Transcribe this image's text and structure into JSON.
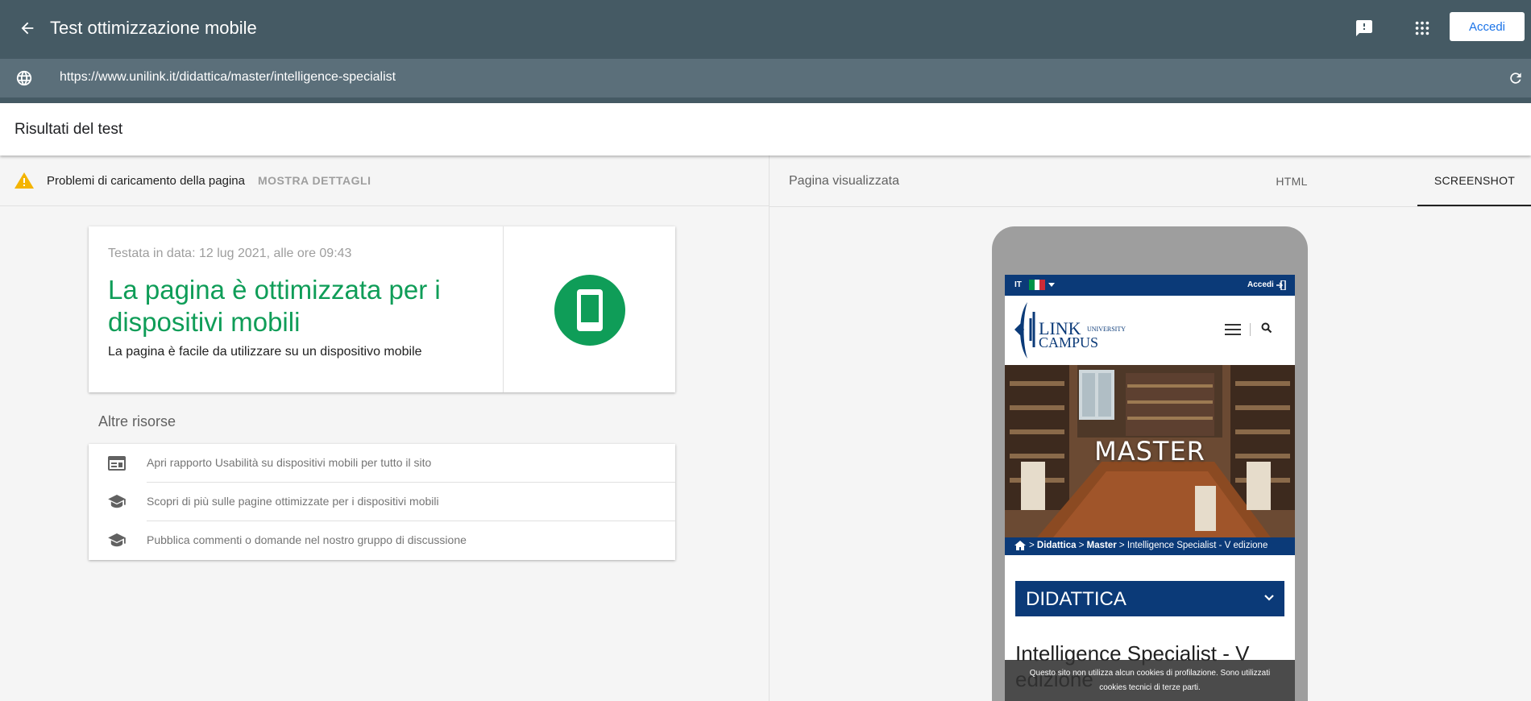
{
  "app": {
    "title": "Test ottimizzazione mobile",
    "signin_label": "Accedi",
    "url": "https://www.unilink.it/didattica/master/intelligence-specialist"
  },
  "results": {
    "title": "Risultati del test",
    "issue_text": "Problemi di caricamento della pagina",
    "details_label": "MOSTRA DETTAGLI"
  },
  "card": {
    "tested": "Testata in data: 12 lug 2021, alle ore 09:43",
    "verdict": "La pagina è ottimizzata per i dispositivi mobili",
    "subtitle": "La pagina è facile da utilizzare su un dispositivo mobile"
  },
  "resources": {
    "title": "Altre risorse",
    "items": [
      {
        "label": "Apri rapporto Usabilità su dispositivi mobili per tutto il sito",
        "icon": "web-report-icon"
      },
      {
        "label": "Scopri di più sulle pagine ottimizzate per i dispositivi mobili",
        "icon": "school-icon"
      },
      {
        "label": "Pubblica commenti o domande nel nostro gruppo di discussione",
        "icon": "school-icon"
      }
    ]
  },
  "rendered": {
    "title": "Pagina visualizzata",
    "tabs": [
      {
        "label": "HTML",
        "selected": false
      },
      {
        "label": "SCREENSHOT",
        "selected": true
      }
    ]
  },
  "preview": {
    "lang": "IT",
    "accedi": "Accedi",
    "logo_main": "LINK",
    "logo_campus": "CAMPUS",
    "logo_university": "UNIVERSITY",
    "hero_title": "MASTER",
    "breadcrumb": {
      "sep": ">",
      "didattica": "Didattica",
      "master": "Master",
      "current": "Intelligence Specialist - V edizione"
    },
    "section": "DIDATTICA",
    "page_title": "Intelligence Specialist - V edizione",
    "cookie_line1": "Questo sito non utilizza alcun cookies di profilazione. Sono utilizzati",
    "cookie_line2": "cookies tecnici di terze parti."
  },
  "colors": {
    "header": "#455a64",
    "url_bar": "#5b6f7a",
    "success": "#0f9d58",
    "warning": "#f4b400",
    "link_blue": "#1a73e8",
    "site_navy": "#0b3a78"
  }
}
